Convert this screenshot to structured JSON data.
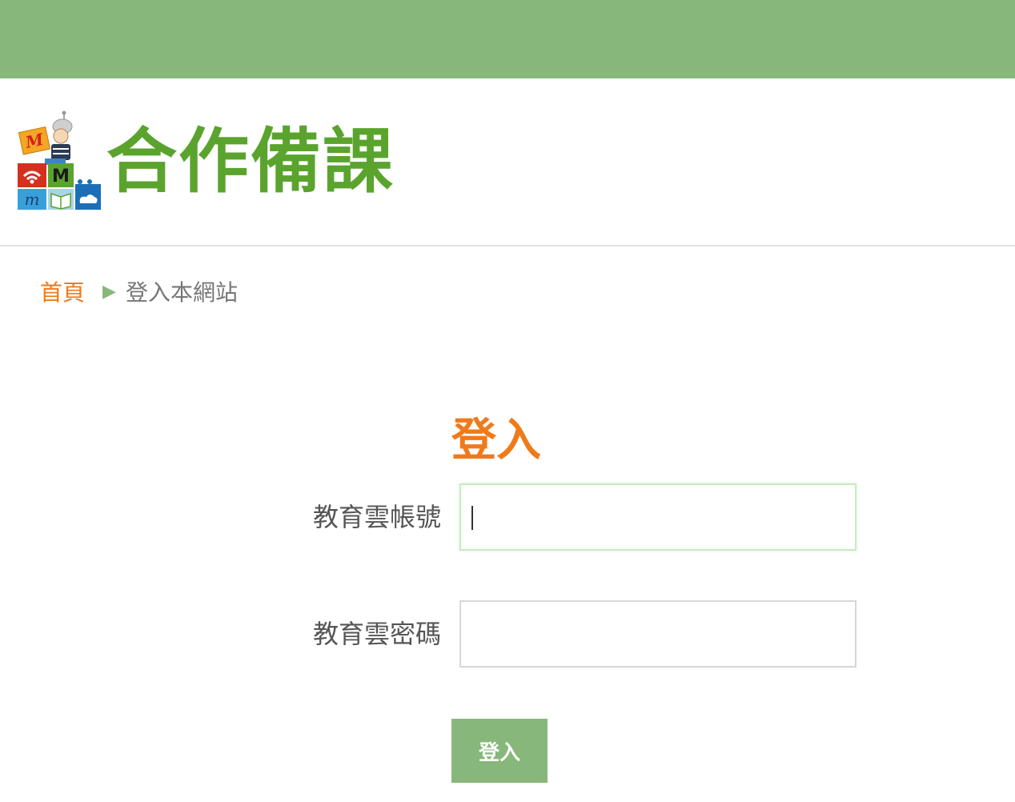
{
  "site": {
    "title": "合作備課",
    "logo_letters": [
      "M",
      "M",
      "m"
    ]
  },
  "breadcrumb": {
    "home": "首頁",
    "separator": "▶",
    "current": "登入本網站"
  },
  "login": {
    "title": "登入",
    "account_label": "教育雲帳號",
    "account_value": "",
    "password_label": "教育雲密碼",
    "password_value": "",
    "submit_label": "登入"
  },
  "colors": {
    "top_bar": "#87b77b",
    "brand_green": "#5aa42e",
    "accent_orange": "#f07a1a",
    "button_green": "#87b77b"
  }
}
